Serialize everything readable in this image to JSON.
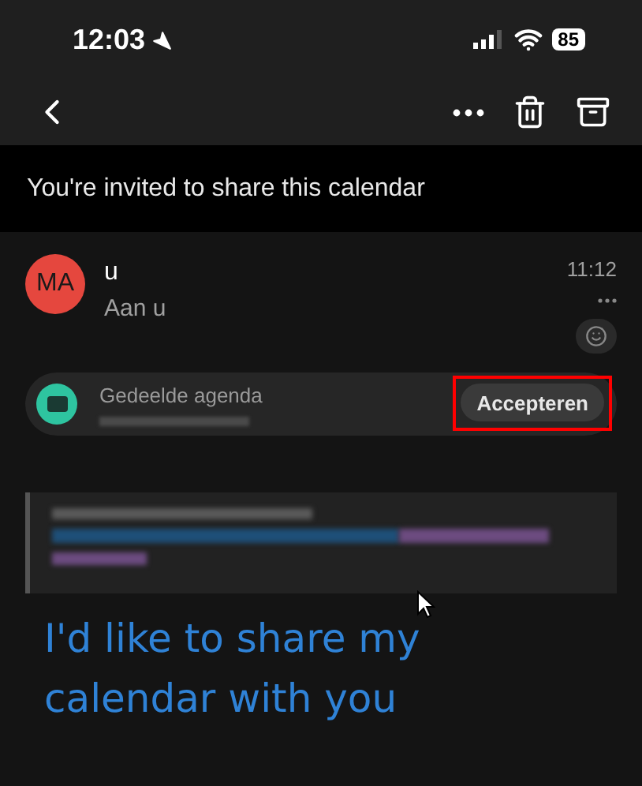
{
  "status_bar": {
    "time": "12:03",
    "battery": "85"
  },
  "subject": "You're invited to share this calendar",
  "message": {
    "avatar": "MA",
    "sender": "u",
    "recipient": "Aan u",
    "time": "11:12"
  },
  "invite": {
    "label": "Gedeelde agenda",
    "button": {
      "label": "Accepteren",
      "highlighted": true
    }
  },
  "body": "I'd like to share my calendar with you"
}
